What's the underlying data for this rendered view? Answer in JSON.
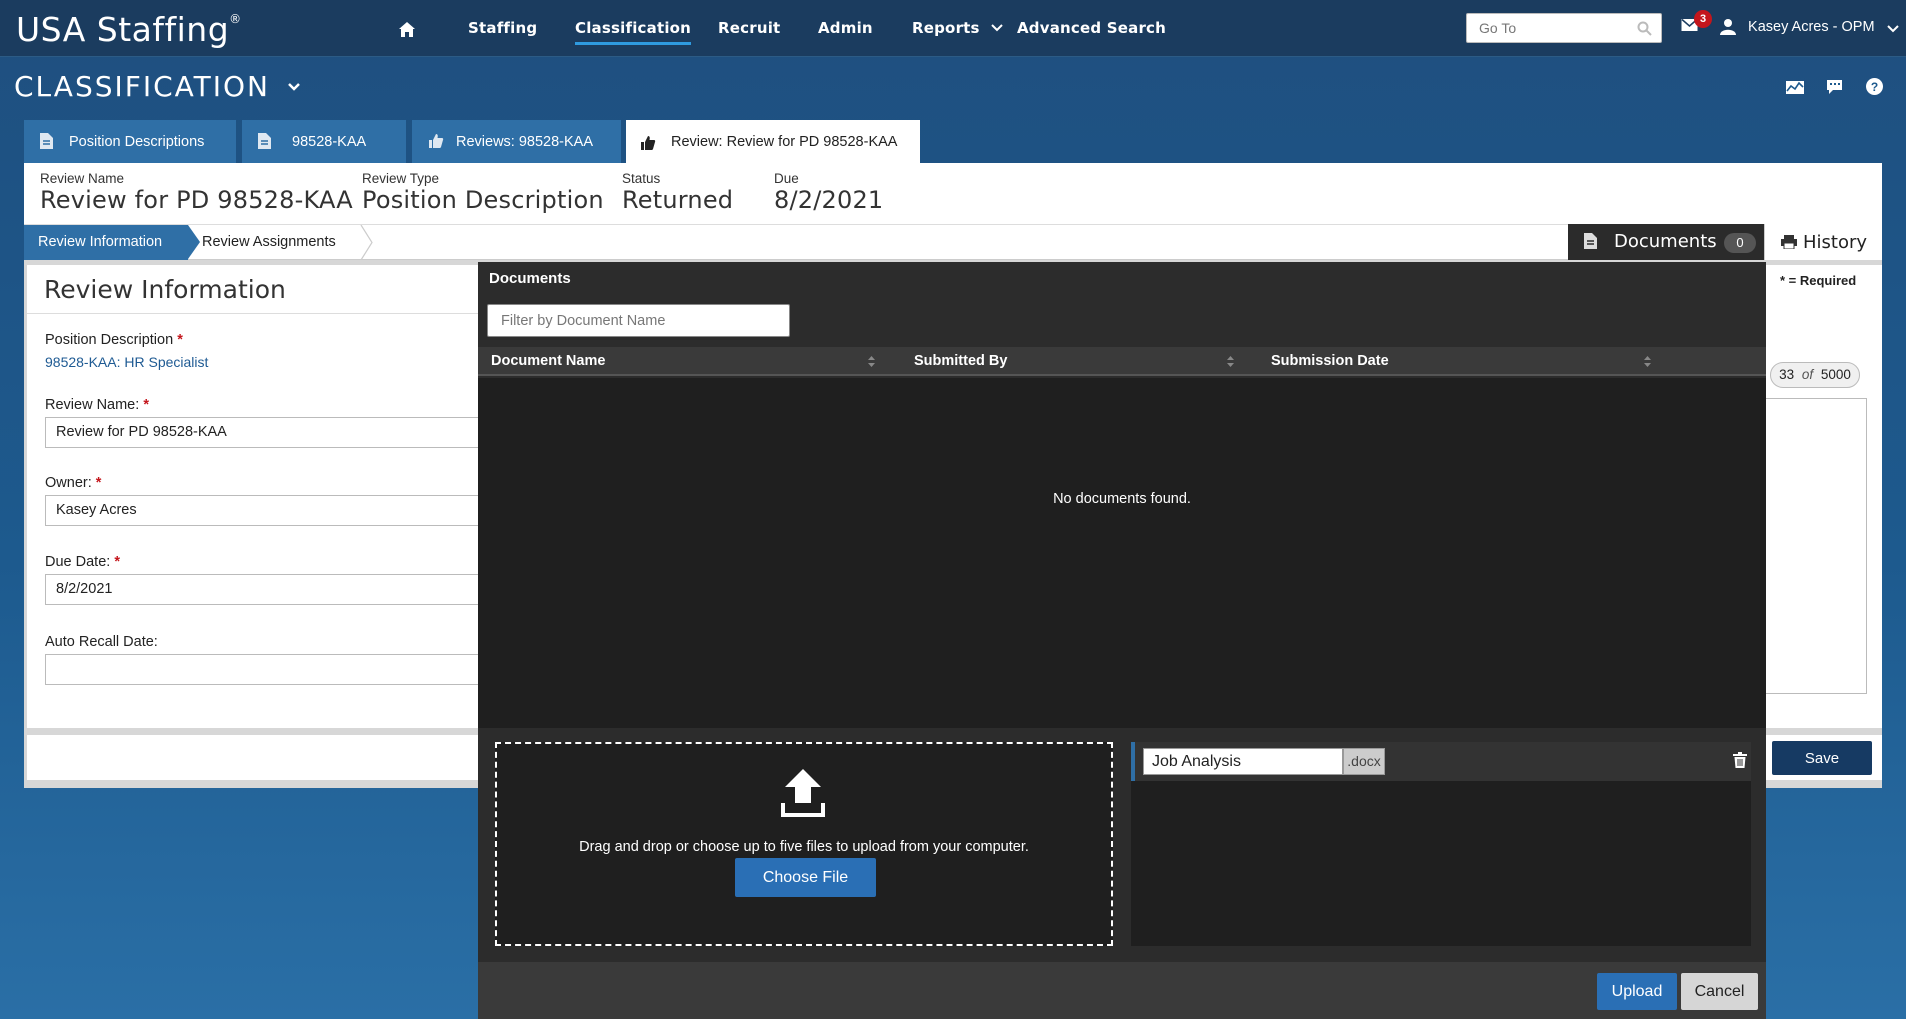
{
  "app": {
    "brand": "USA Staffing",
    "brand_mark": "®"
  },
  "nav": {
    "items": [
      "Staffing",
      "Classification",
      "Recruit",
      "Admin",
      "Reports",
      "Advanced Search"
    ],
    "active": "Classification"
  },
  "goto": {
    "placeholder": "Go To"
  },
  "notifications": {
    "count": "3"
  },
  "user": {
    "name": "Kasey Acres - OPM"
  },
  "module": {
    "title": "CLASSIFICATION"
  },
  "tabs": [
    {
      "label": "Position Descriptions",
      "icon": "document-icon"
    },
    {
      "label": "98528-KAA",
      "icon": "document-icon"
    },
    {
      "label": "Reviews: 98528-KAA",
      "icon": "thumbs-up-icon"
    },
    {
      "label": "Review: Review for PD 98528-KAA",
      "icon": "thumbs-up-icon",
      "active": true
    }
  ],
  "header": {
    "review_name_label": "Review Name",
    "review_name": "Review for PD 98528-KAA",
    "review_type_label": "Review Type",
    "review_type": "Position Description",
    "status_label": "Status",
    "status": "Returned",
    "due_label": "Due",
    "due": "8/2/2021"
  },
  "subnav": {
    "active": "Review Information",
    "second": "Review Assignments",
    "documents_label": "Documents",
    "documents_count": "0",
    "history_label": "History"
  },
  "form": {
    "title": "Review Information",
    "pd_label": "Position Description",
    "pd_value": "98528-KAA: HR Specialist",
    "review_name_label": "Review Name:",
    "review_name_value": "Review for PD 98528-KAA",
    "owner_label": "Owner:",
    "owner_value": "Kasey Acres",
    "due_label": "Due Date:",
    "due_value": "8/2/2021",
    "recall_label": "Auto Recall Date:",
    "recall_value": "",
    "required_mark": "*"
  },
  "right_strip": {
    "required_note": "* = Required",
    "counter_current": "33",
    "counter_of": "of",
    "counter_max": "5000",
    "save_label": "Save"
  },
  "modal": {
    "title": "Documents",
    "filter_placeholder": "Filter by Document Name",
    "columns": [
      "Document Name",
      "Submitted By",
      "Submission Date"
    ],
    "empty_text": "No documents found.",
    "dropzone_text": "Drag and drop or choose up to five files to upload from your computer.",
    "choose_label": "Choose File",
    "file": {
      "name": "Job Analysis",
      "ext": ".docx"
    },
    "upload_label": "Upload",
    "cancel_label": "Cancel"
  },
  "colors": {
    "topbar": "#1b3c5f",
    "accent": "#2f6fa6",
    "modal": "#2c2c2c",
    "required": "#c4161c",
    "save": "#163a63"
  }
}
